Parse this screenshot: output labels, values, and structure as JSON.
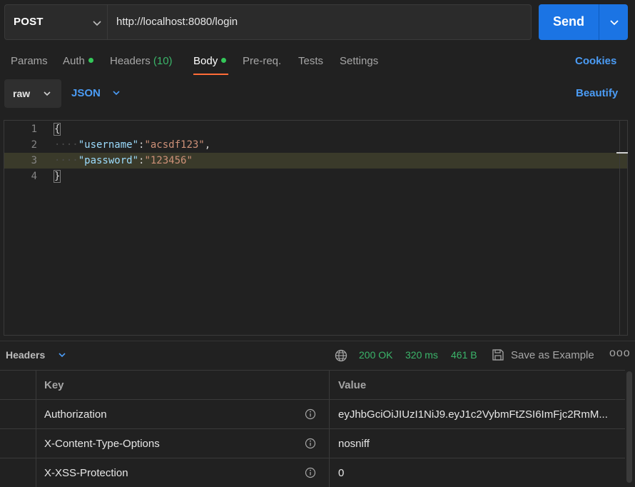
{
  "request": {
    "method": "POST",
    "url": "http://localhost:8080/login",
    "send_label": "Send"
  },
  "tabs": [
    {
      "label": "Params",
      "dot": false
    },
    {
      "label": "Auth",
      "dot": true
    },
    {
      "label": "Headers",
      "count": "(10)",
      "dot": false
    },
    {
      "label": "Body",
      "dot": true,
      "active": true
    },
    {
      "label": "Pre-req.",
      "dot": false
    },
    {
      "label": "Tests",
      "dot": false
    },
    {
      "label": "Settings",
      "dot": false
    }
  ],
  "cookies_label": "Cookies",
  "body_toolbar": {
    "mode": "raw",
    "format": "JSON",
    "beautify_label": "Beautify"
  },
  "editor": {
    "line_numbers": [
      "1",
      "2",
      "3",
      "4"
    ],
    "open_brace": "{",
    "close_brace": "}",
    "username_key": "\"username\"",
    "username_value": "\"acsdf123\"",
    "password_key": "\"password\"",
    "password_value": "\"123456\""
  },
  "response": {
    "section_title": "Headers",
    "status": "200 OK",
    "time": "320 ms",
    "size": "461 B",
    "save_label": "Save as Example",
    "more_label": "ooo",
    "columns": {
      "key": "Key",
      "value": "Value"
    },
    "headers": [
      {
        "key": "Authorization",
        "value": "eyJhbGciOiJIUzI1NiJ9.eyJ1c2VybmFtZSI6ImFjc2RmM..."
      },
      {
        "key": "X-Content-Type-Options",
        "value": "nosniff"
      },
      {
        "key": "X-XSS-Protection",
        "value": "0"
      }
    ]
  },
  "colors": {
    "accent": "#1b74e4",
    "link": "#4b9cf5",
    "success": "#3bb56a",
    "active_tab_underline": "#ff6c37",
    "background": "#212121"
  }
}
